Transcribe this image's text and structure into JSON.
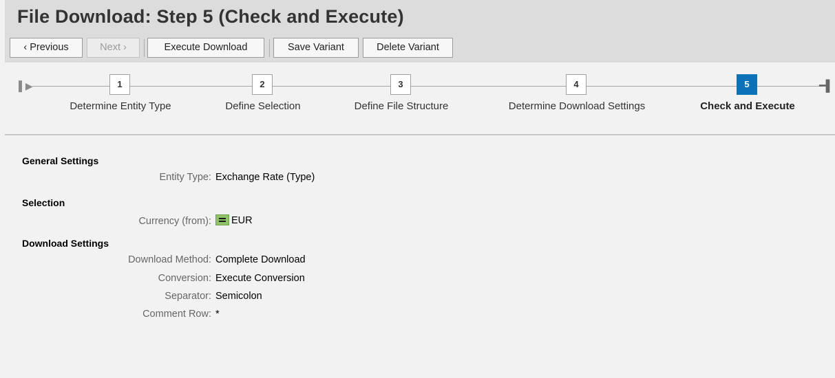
{
  "page": {
    "title": "File Download: Step 5  (Check and Execute)"
  },
  "toolbar": {
    "previous_label": "‹ Previous",
    "next_label": "Next ›",
    "execute_label": "Execute Download",
    "save_variant_label": "Save Variant",
    "delete_variant_label": "Delete Variant"
  },
  "roadmap": {
    "steps": [
      {
        "number": "1",
        "label": "Determine Entity Type",
        "active": false
      },
      {
        "number": "2",
        "label": "Define Selection",
        "active": false
      },
      {
        "number": "3",
        "label": "Define File Structure",
        "active": false
      },
      {
        "number": "4",
        "label": "Determine Download Settings",
        "active": false
      },
      {
        "number": "5",
        "label": "Check and Execute",
        "active": true
      }
    ],
    "accent_color": "#0a73b8"
  },
  "general": {
    "title": "General Settings",
    "entity_type_label": "Entity Type:",
    "entity_type_value": "Exchange Rate (Type)"
  },
  "selection": {
    "title": "Selection",
    "currency_label": "Currency (from):",
    "currency_icon": "equals-icon",
    "currency_value": "EUR"
  },
  "download": {
    "title": "Download Settings",
    "method_label": "Download Method:",
    "method_value": "Complete Download",
    "conversion_label": "Conversion:",
    "conversion_value": "Execute Conversion",
    "separator_label": "Separator:",
    "separator_value": "Semicolon",
    "comment_label": "Comment Row:",
    "comment_value": "*"
  }
}
